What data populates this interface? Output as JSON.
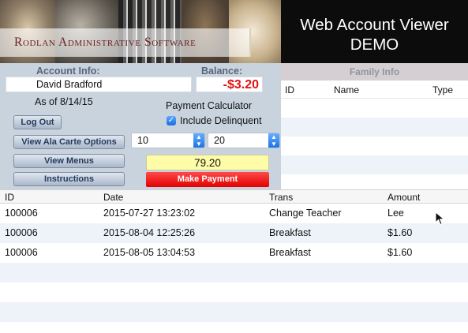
{
  "header": {
    "company_name": "Rodlan Administrative Software",
    "app_title": "Web Account Viewer\nDEMO"
  },
  "account": {
    "info_label": "Account Info:",
    "balance_label": "Balance:",
    "name": "David  Bradford",
    "balance": "-$3.20",
    "as_of": "As of 8/14/15"
  },
  "calculator": {
    "label": "Payment Calculator",
    "include_delinquent_label": "Include Delinquent",
    "include_delinquent_checked": true,
    "stepper_a_value": "10",
    "stepper_b_value": "20",
    "result": "79.20",
    "make_payment_label": "Make Payment"
  },
  "buttons": {
    "logout": "Log Out",
    "ala_carte": "View Ala Carte Options",
    "menus": "View Menus",
    "instructions": "Instructions"
  },
  "family": {
    "title": "Family Info",
    "columns": [
      "ID",
      "Name",
      "Type"
    ],
    "rows": []
  },
  "transactions": {
    "columns": [
      "ID",
      "Date",
      "Trans",
      "Amount"
    ],
    "rows": [
      {
        "id": "100006",
        "date": "2015-07-27 13:23:02",
        "trans": "Change Teacher",
        "amount": "Lee"
      },
      {
        "id": "100006",
        "date": "2015-08-04 12:25:26",
        "trans": "Breakfast",
        "amount": "$1.60"
      },
      {
        "id": "100006",
        "date": "2015-08-05 13:04:53",
        "trans": "Breakfast",
        "amount": "$1.60"
      }
    ]
  },
  "colors": {
    "balance_negative": "#e11212",
    "make_payment_bg": "#e20000",
    "result_bg": "#fffca8",
    "panel_bg": "#c9d3de",
    "title_bar_bg": "#0c0c0c",
    "company_name_color": "#6a1d20"
  },
  "icons": {
    "checkbox": "checkmark-icon",
    "stepper": "updown-arrows-icon",
    "cursor": "mouse-pointer-icon"
  }
}
